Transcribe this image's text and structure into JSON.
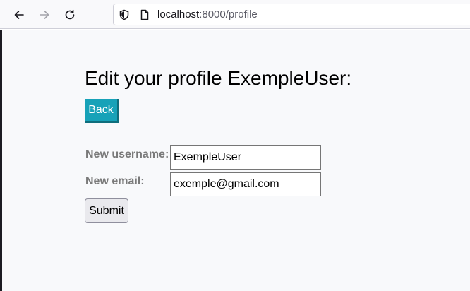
{
  "browser": {
    "url_host": "localhost",
    "url_rest": ":8000/profile",
    "icons": {
      "back": "arrow-left-icon",
      "forward": "arrow-right-icon",
      "reload": "reload-icon",
      "tracking": "shield-icon",
      "page": "page-icon"
    }
  },
  "page": {
    "title": "Edit your profile ExempleUser:",
    "back_label": "Back",
    "form": {
      "username_label": "New username:",
      "username_value": "ExempleUser",
      "email_label": "New email:",
      "email_value": "exemple@gmail.com",
      "submit_label": "Submit"
    }
  },
  "colors": {
    "back_button_bg": "#17a2b8",
    "page_bg": "#f8f9fb",
    "label_color": "#7a7a7a"
  }
}
